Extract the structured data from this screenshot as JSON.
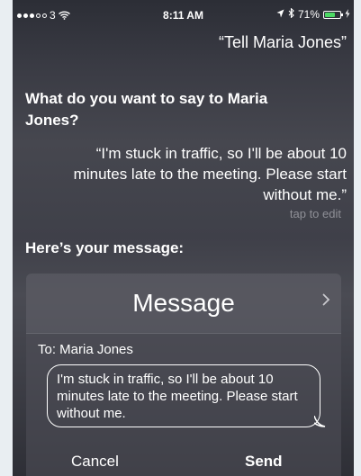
{
  "status_bar": {
    "carrier": "3",
    "time": "8:11 AM",
    "battery": "71%",
    "battery_level": 0.71,
    "icons": [
      "signal-dots",
      "wifi-icon",
      "location-arrow-icon",
      "bluetooth-icon",
      "battery-icon",
      "charging-icon"
    ]
  },
  "conversation": {
    "user_query": "“Tell Maria Jones”",
    "siri_question": "What do you want to say to Maria Jones?",
    "dictated_text": "“I'm stuck in traffic, so I'll be about 10 minutes late to the meeting. Please start without me.”",
    "tap_to_edit": "tap to edit",
    "heres_message": "Here’s your message:"
  },
  "message_card": {
    "title": "Message",
    "to_line": "To: Maria Jones",
    "body": "I'm stuck in traffic, so I'll be about 10 minutes late to the meeting. Please start without me.",
    "cancel_label": "Cancel",
    "send_label": "Send"
  }
}
